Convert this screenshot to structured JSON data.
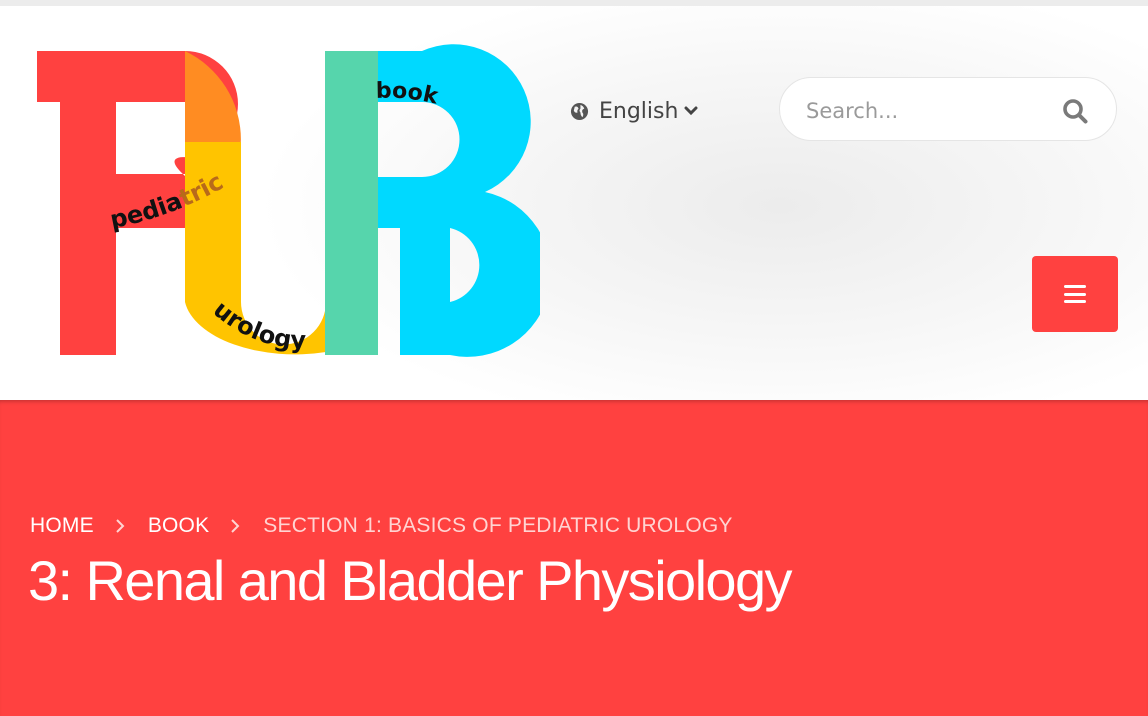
{
  "logo": {
    "letters": "PUB",
    "words": [
      "pediatric",
      "urology",
      "book"
    ],
    "colors": {
      "red": "#ff4140",
      "orange": "#ff8c22",
      "yellow": "#ffc400",
      "green": "#56d5ac",
      "cyan": "#00d9ff"
    }
  },
  "language": {
    "icon": "globe-icon",
    "label": "English",
    "caret": "chevron-down-icon"
  },
  "search": {
    "placeholder": "Search...",
    "icon": "search-icon"
  },
  "menu": {
    "icon": "hamburger-icon",
    "color": "#ff4140"
  },
  "breadcrumb": {
    "items": [
      "HOME",
      "BOOK",
      "SECTION 1: BASICS OF PEDIATRIC UROLOGY"
    ],
    "separator_icon": "chevron-right-icon"
  },
  "page": {
    "title": "3: Renal and Bladder Physiology"
  },
  "colors": {
    "accent": "#ff4140",
    "header_bg": "#f3f3f3"
  }
}
